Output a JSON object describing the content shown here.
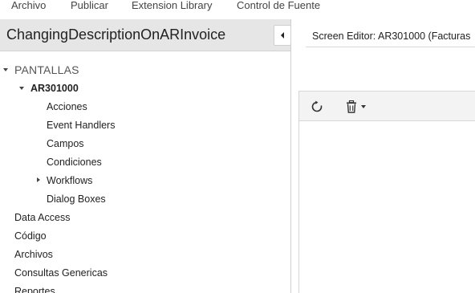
{
  "menu": {
    "items": [
      "Archivo",
      "Publicar",
      "Extension Library",
      "Control de Fuente"
    ]
  },
  "project": {
    "title": "ChangingDescriptionOnARInvoice"
  },
  "tree": {
    "root": "PANTALLAS",
    "screen": "AR301000",
    "screen_children": [
      "Acciones",
      "Event Handlers",
      "Campos",
      "Condiciones",
      "Workflows",
      "Dialog Boxes"
    ],
    "sections": [
      "Data Access",
      "Código",
      "Archivos",
      "Consultas Genericas",
      "Reportes"
    ]
  },
  "editor": {
    "tab_title": "Screen Editor: AR301000 (Facturas"
  },
  "toolbar": {
    "icons": [
      "refresh-icon",
      "delete-icon",
      "chevron-down-icon"
    ]
  },
  "colors": {
    "title_bar": "#e6e6e6",
    "toolbar_bg": "#f3f3f3",
    "border": "#d6d6d6"
  }
}
